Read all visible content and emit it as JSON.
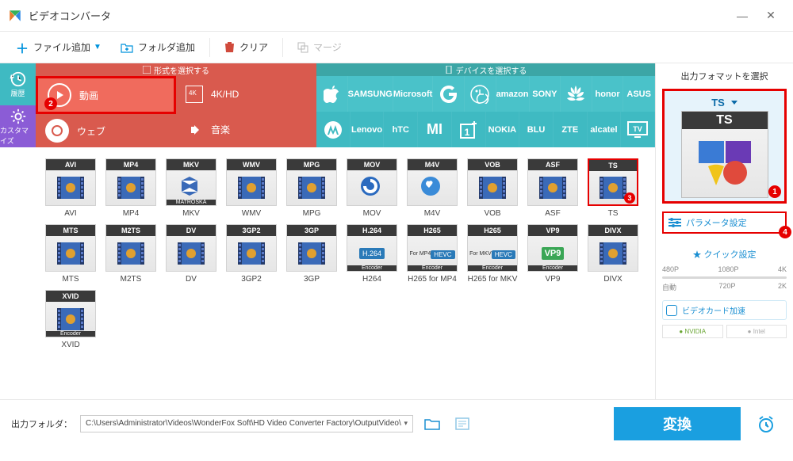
{
  "titlebar": {
    "title": "ビデオコンバータ"
  },
  "toolbar": {
    "add_file": "ファイル追加",
    "add_folder": "フォルダ追加",
    "clear": "クリア",
    "merge": "マージ"
  },
  "rail": {
    "history": "履歴",
    "customize": "カスタマイズ"
  },
  "cat_header": {
    "format": "形式を選択する",
    "device": "デバイスを選択する"
  },
  "red_tabs": {
    "video": "動画",
    "web": "ウェブ"
  },
  "grey_tabs": {
    "hd": "4K/HD",
    "music": "音楽"
  },
  "brands_row1": [
    "Apple",
    "SAMSUNG",
    "Microsoft",
    "Google",
    "LG",
    "amazon",
    "SONY",
    "HUAWEI",
    "honor",
    "ASUS"
  ],
  "brands_row2": [
    "Motorola",
    "Lenovo",
    "hTC",
    "Xiaomi",
    "OnePlus",
    "NOKIA",
    "BLU",
    "ZTE",
    "alcatel",
    "TV"
  ],
  "formats_row1": [
    {
      "tag": "AVI",
      "label": "AVI"
    },
    {
      "tag": "MP4",
      "label": "MP4"
    },
    {
      "tag": "MKV",
      "label": "MKV",
      "sub": "MATROSKA"
    },
    {
      "tag": "WMV",
      "label": "WMV"
    },
    {
      "tag": "MPG",
      "label": "MPG"
    },
    {
      "tag": "MOV",
      "label": "MOV"
    },
    {
      "tag": "M4V",
      "label": "M4V"
    },
    {
      "tag": "VOB",
      "label": "VOB"
    },
    {
      "tag": "ASF",
      "label": "ASF"
    },
    {
      "tag": "TS",
      "label": "TS",
      "selected": true
    }
  ],
  "formats_row2": [
    {
      "tag": "MTS",
      "label": "MTS"
    },
    {
      "tag": "M2TS",
      "label": "M2TS"
    },
    {
      "tag": "DV",
      "label": "DV"
    },
    {
      "tag": "3GP2",
      "label": "3GP2"
    },
    {
      "tag": "3GP",
      "label": "3GP"
    },
    {
      "tag": "H.264",
      "label": "H264",
      "sub": "Encoder"
    },
    {
      "tag": "H265",
      "label": "H265 for MP4",
      "sub": "Encoder",
      "mid": "HEVC",
      "mid2": "For MP4"
    },
    {
      "tag": "H265",
      "label": "H265 for MKV",
      "sub": "Encoder",
      "mid": "HEVC",
      "mid2": "For MKV"
    },
    {
      "tag": "VP9",
      "label": "VP9",
      "sub": "Encoder",
      "vp": true
    },
    {
      "tag": "DIVX",
      "label": "DIVX"
    }
  ],
  "formats_row3": [
    {
      "tag": "XVID",
      "label": "XVID",
      "sub": "Encoder"
    }
  ],
  "rightpanel": {
    "title": "出力フォマットを選択",
    "preview_format": "TS",
    "params": "パラメータ設定",
    "quick": "クイック設定",
    "marks_top": [
      "480P",
      "1080P",
      "4K"
    ],
    "marks_bottom": [
      "自動",
      "720P",
      "2K"
    ],
    "gpu": "ビデオカード加速",
    "vendors": [
      "NVIDIA",
      "Intel"
    ]
  },
  "footer": {
    "label": "出力フォルダ：",
    "path": "C:\\Users\\Administrator\\Videos\\WonderFox Soft\\HD Video Converter Factory\\OutputVideo\\",
    "convert": "変換"
  },
  "callouts": {
    "video": "2",
    "ts": "3",
    "preview": "1",
    "params": "4"
  }
}
